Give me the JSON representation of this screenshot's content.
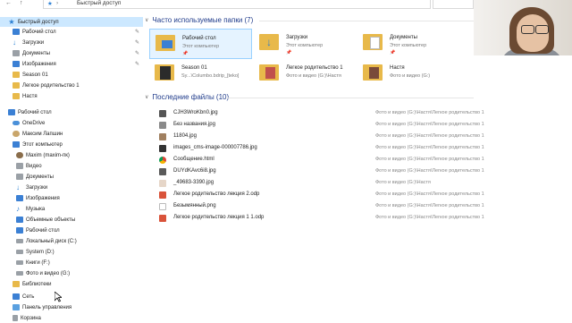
{
  "address_bar": {
    "path_label": "Быстрый доступ",
    "nav_back": "←",
    "nav_up": "↑"
  },
  "sidebar": {
    "items": [
      {
        "label": "Быстрый доступ",
        "icon": "star-icon",
        "selected": true
      },
      {
        "label": "Рабочий стол",
        "icon": "desktop-icon",
        "pinned": true
      },
      {
        "label": "Загрузки",
        "icon": "download-icon",
        "pinned": true
      },
      {
        "label": "Документы",
        "icon": "documents-icon",
        "pinned": true
      },
      {
        "label": "Изображения",
        "icon": "pictures-icon",
        "pinned": true
      },
      {
        "label": "Season 01",
        "icon": "folder-icon"
      },
      {
        "label": "Легкое родительство 1",
        "icon": "folder-icon"
      },
      {
        "label": "Настя",
        "icon": "folder-icon"
      },
      {
        "label": "Рабочий стол",
        "icon": "desktop-icon"
      },
      {
        "label": "OneDrive",
        "icon": "cloud-icon"
      },
      {
        "label": "Максим Лапшин",
        "icon": "user-icon"
      },
      {
        "label": "Этот компьютер",
        "icon": "computer-icon"
      },
      {
        "label": "Maxim (maxim-пк)",
        "icon": "user-icon"
      },
      {
        "label": "Видео",
        "icon": "video-icon"
      },
      {
        "label": "Документы",
        "icon": "documents-icon"
      },
      {
        "label": "Загрузки",
        "icon": "download-icon"
      },
      {
        "label": "Изображения",
        "icon": "pictures-icon"
      },
      {
        "label": "Музыка",
        "icon": "music-icon"
      },
      {
        "label": "Объемные объекты",
        "icon": "3d-objects-icon"
      },
      {
        "label": "Рабочий стол",
        "icon": "desktop-icon"
      },
      {
        "label": "Локальный диск (C:)",
        "icon": "drive-icon"
      },
      {
        "label": "System (D:)",
        "icon": "drive-icon"
      },
      {
        "label": "Книги (F:)",
        "icon": "drive-icon"
      },
      {
        "label": "Фото и видео (G:)",
        "icon": "drive-icon"
      },
      {
        "label": "Библиотеки",
        "icon": "library-icon"
      },
      {
        "label": "Сеть",
        "icon": "network-icon"
      },
      {
        "label": "Панель управления",
        "icon": "control-panel-icon"
      },
      {
        "label": "Корзина",
        "icon": "recycle-bin-icon"
      }
    ]
  },
  "frequent": {
    "header": "Часто используемые папки (7)",
    "tiles": [
      {
        "title": "Рабочий стол",
        "subtitle": "Этот компьютер",
        "pinned": true
      },
      {
        "title": "Загрузки",
        "subtitle": "Этот компьютер",
        "pinned": true
      },
      {
        "title": "Документы",
        "subtitle": "Этот компьютер",
        "pinned": true
      },
      {
        "title": "Season 01",
        "subtitle": "Sy...\\Columbo.bdrip_[teko]"
      },
      {
        "title": "Легкое родительство 1",
        "subtitle": "Фото и видео (G:)\\Настя"
      },
      {
        "title": "Настя",
        "subtitle": "Фото и видео (G:)"
      }
    ],
    "pin_glyph": "📌"
  },
  "recent": {
    "header": "Последние файлы (10)",
    "files": [
      {
        "name": "CJH3WroKbn0.jpg",
        "path": "Фото и видео (G:)\\Настя\\Легкое родительство 1",
        "icon": "image-icon"
      },
      {
        "name": "Без названия.jpg",
        "path": "Фото и видео (G:)\\Настя\\Легкое родительство 1",
        "icon": "image-icon"
      },
      {
        "name": "11804.jpg",
        "path": "Фото и видео (G:)\\Настя\\Легкое родительство 1",
        "icon": "image-icon"
      },
      {
        "name": "images_cms-image-000007786.jpg",
        "path": "Фото и видео (G:)\\Настя\\Легкое родительство 1",
        "icon": "image-icon"
      },
      {
        "name": "Сообщение.html",
        "path": "Фото и видео (G:)\\Настя\\Легкое родительство 1",
        "icon": "chrome-icon"
      },
      {
        "name": "DUYdKAvc6i8.jpg",
        "path": "Фото и видео (G:)\\Настя\\Легкое родительство 1",
        "icon": "image-icon"
      },
      {
        "name": "_49683-3390.jpg",
        "path": "Фото и видео (G:)\\Настя",
        "icon": "image-icon"
      },
      {
        "name": "Легкое родительство лекция 2.odp",
        "path": "Фото и видео (G:)\\Настя\\Легкое родительство 1",
        "icon": "presentation-icon"
      },
      {
        "name": "Безымянный.png",
        "path": "Фото и видео (G:)\\Настя\\Легкое родительство 1",
        "icon": "image-icon"
      },
      {
        "name": "Легкое родительство лекция 1 1.odp",
        "path": "Фото и видео (G:)\\Настя\\Легкое родительство 1",
        "icon": "presentation-icon"
      }
    ]
  },
  "colors": {
    "accent": "#1e3a8a",
    "selection": "#cce8ff",
    "folder": "#e8b94a"
  }
}
